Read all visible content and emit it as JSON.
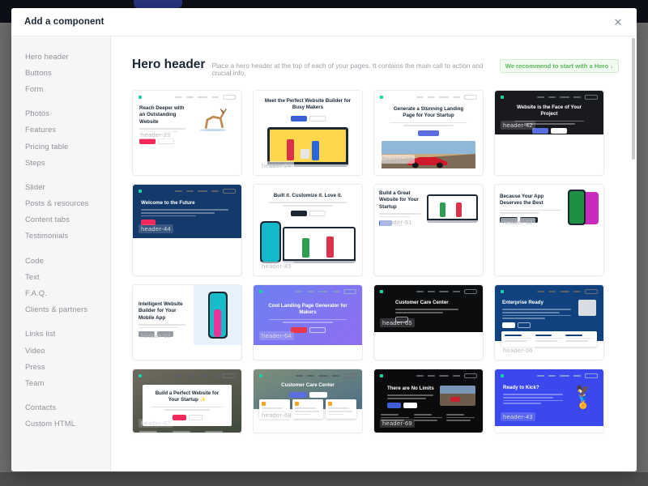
{
  "window": {
    "modal_title": "Add a component",
    "close_icon": "close-icon"
  },
  "sidebar": {
    "groups": [
      {
        "items": [
          {
            "label": "Hero header"
          },
          {
            "label": "Buttons"
          },
          {
            "label": "Form"
          }
        ]
      },
      {
        "items": [
          {
            "label": "Photos"
          },
          {
            "label": "Features"
          },
          {
            "label": "Pricing table"
          },
          {
            "label": "Steps"
          }
        ]
      },
      {
        "items": [
          {
            "label": "Slider"
          },
          {
            "label": "Posts & resources"
          },
          {
            "label": "Content tabs"
          },
          {
            "label": "Testimonials"
          }
        ]
      },
      {
        "items": [
          {
            "label": "Code"
          },
          {
            "label": "Text"
          },
          {
            "label": "F.A.Q."
          },
          {
            "label": "Clients & partners"
          }
        ]
      },
      {
        "items": [
          {
            "label": "Links list"
          },
          {
            "label": "Video"
          },
          {
            "label": "Press"
          },
          {
            "label": "Team"
          }
        ]
      },
      {
        "items": [
          {
            "label": "Contacts"
          },
          {
            "label": "Custom HTML"
          }
        ]
      }
    ]
  },
  "section": {
    "title": "Hero header",
    "description": "Place a hero header at the top of each of your pages. It contains the main call to action and crucial info.",
    "badge": "We recommend to start with a Hero ↓",
    "badge_color": "#5cb85c",
    "badge_bg": "#f2fbf2"
  },
  "cards": [
    {
      "id": "header-23",
      "headline": "Reach Deeper with an Outstanding Website",
      "theme": "light"
    },
    {
      "id": "header-24",
      "headline": "Meet the Perfect Website Builder for Busy Makers",
      "theme": "light"
    },
    {
      "id": "header-27",
      "headline": "Generate a Stunning Landing Page for Your Startup",
      "theme": "light"
    },
    {
      "id": "header-42",
      "headline": "Website is the Face of Your Project",
      "theme": "dark"
    },
    {
      "id": "header-44",
      "headline": "Welcome to the Future",
      "theme": "navy"
    },
    {
      "id": "header-45",
      "headline": "Built it. Customize it. Love it.",
      "theme": "light"
    },
    {
      "id": "header-61",
      "headline": "Build a Great Website for Your Startup",
      "theme": "light"
    },
    {
      "id": "header-62",
      "headline": "Because Your App Deserves the Best",
      "theme": "light"
    },
    {
      "id": "header-63",
      "headline": "Intelligent Website Builder for Your Mobile App",
      "theme": "light"
    },
    {
      "id": "header-64",
      "headline": "Cool Landing Page Generator for Makers",
      "theme": "violet"
    },
    {
      "id": "header-65",
      "headline": "Customer Care Center",
      "theme": "dark"
    },
    {
      "id": "header-66",
      "headline": "Enterprise Ready",
      "theme": "navy"
    },
    {
      "id": "header-67",
      "headline": "Build a Perfect Website for Your Startup ✨",
      "theme": "photo"
    },
    {
      "id": "header-68",
      "headline": "Customer Care Center",
      "theme": "photo"
    },
    {
      "id": "header-69",
      "headline": "There are No Limits",
      "theme": "dark"
    },
    {
      "id": "header-43",
      "headline": "Ready to Kick?",
      "theme": "blue"
    }
  ]
}
